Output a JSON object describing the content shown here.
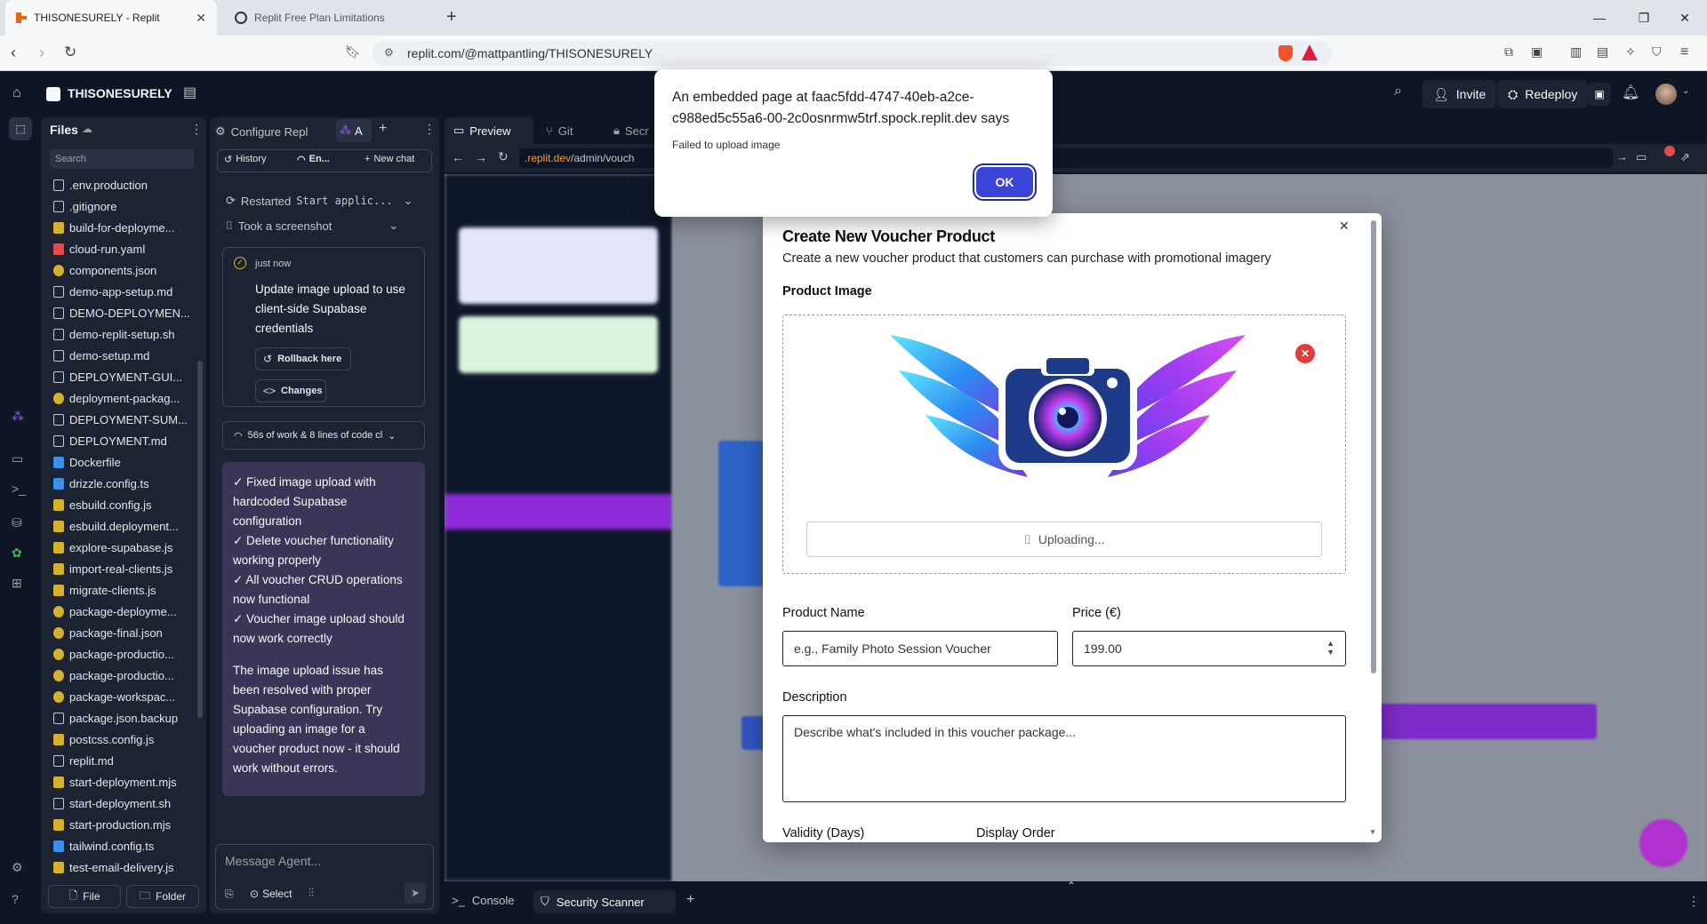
{
  "browser": {
    "tabs": [
      {
        "title": "THISONESURELY - Replit",
        "active": true
      },
      {
        "title": "Replit Free Plan Limitations",
        "active": false
      }
    ],
    "url": "replit.com/@mattpantling/THISONESURELY"
  },
  "topbar": {
    "project_name": "THISONESURELY",
    "invite_label": "Invite",
    "redeploy_label": "Redeploy"
  },
  "files": {
    "title": "Files",
    "search_placeholder": "Search",
    "items": [
      {
        "name": ".env.production",
        "icon": "doc",
        "color": "#c5c9d0"
      },
      {
        "name": ".gitignore",
        "icon": "doc",
        "color": "#c5c9d0"
      },
      {
        "name": "build-for-deployme...",
        "icon": "js",
        "color": "#d8b12c"
      },
      {
        "name": "cloud-run.yaml",
        "icon": "yaml",
        "color": "#e44b4b"
      },
      {
        "name": "components.json",
        "icon": "json",
        "color": "#d8b12c"
      },
      {
        "name": "demo-app-setup.md",
        "icon": "md",
        "color": "#c5c9d0"
      },
      {
        "name": "DEMO-DEPLOYMEN...",
        "icon": "md",
        "color": "#c5c9d0"
      },
      {
        "name": "demo-replit-setup.sh",
        "icon": "sh",
        "color": "#c5c9d0"
      },
      {
        "name": "demo-setup.md",
        "icon": "md",
        "color": "#c5c9d0"
      },
      {
        "name": "DEPLOYMENT-GUI...",
        "icon": "md",
        "color": "#c5c9d0"
      },
      {
        "name": "deployment-packag...",
        "icon": "json",
        "color": "#d8b12c"
      },
      {
        "name": "DEPLOYMENT-SUM...",
        "icon": "md",
        "color": "#c5c9d0"
      },
      {
        "name": "DEPLOYMENT.md",
        "icon": "md",
        "color": "#c5c9d0"
      },
      {
        "name": "Dockerfile",
        "icon": "docker",
        "color": "#3b8eea"
      },
      {
        "name": "drizzle.config.ts",
        "icon": "ts",
        "color": "#3b8eea"
      },
      {
        "name": "esbuild.config.js",
        "icon": "js",
        "color": "#d8b12c"
      },
      {
        "name": "esbuild.deployment...",
        "icon": "js",
        "color": "#d8b12c"
      },
      {
        "name": "explore-supabase.js",
        "icon": "js",
        "color": "#d8b12c"
      },
      {
        "name": "import-real-clients.js",
        "icon": "js",
        "color": "#d8b12c"
      },
      {
        "name": "migrate-clients.js",
        "icon": "js",
        "color": "#d8b12c"
      },
      {
        "name": "package-deployme...",
        "icon": "json",
        "color": "#d8b12c"
      },
      {
        "name": "package-final.json",
        "icon": "json",
        "color": "#d8b12c"
      },
      {
        "name": "package-productio...",
        "icon": "json",
        "color": "#d8b12c"
      },
      {
        "name": "package-productio...",
        "icon": "json",
        "color": "#d8b12c"
      },
      {
        "name": "package-workspac...",
        "icon": "json",
        "color": "#d8b12c"
      },
      {
        "name": "package.json.backup",
        "icon": "md",
        "color": "#c5c9d0"
      },
      {
        "name": "postcss.config.js",
        "icon": "js",
        "color": "#d8b12c"
      },
      {
        "name": "replit.md",
        "icon": "md",
        "color": "#c5c9d0"
      },
      {
        "name": "start-deployment.mjs",
        "icon": "js",
        "color": "#d8b12c"
      },
      {
        "name": "start-deployment.sh",
        "icon": "sh",
        "color": "#c5c9d0"
      },
      {
        "name": "start-production.mjs",
        "icon": "js",
        "color": "#d8b12c"
      },
      {
        "name": "tailwind.config.ts",
        "icon": "ts",
        "color": "#3b8eea"
      },
      {
        "name": "test-email-delivery.js",
        "icon": "js",
        "color": "#d8b12c"
      }
    ],
    "new_file_label": "File",
    "new_folder_label": "Folder"
  },
  "agent": {
    "tabs": {
      "configure": "Configure Repl",
      "agent": "A"
    },
    "history_label": "History",
    "mode_label": "En...",
    "new_chat_label": "New chat",
    "actions": [
      {
        "label": "Restarted",
        "mono": "Start applic..."
      },
      {
        "label": "Took a screenshot",
        "mono": ""
      }
    ],
    "checkpoint": {
      "time": "just now",
      "message": "Update image upload to use client-side Supabase credentials",
      "rollback_label": "Rollback here",
      "changes_label": "Changes"
    },
    "work_summary": "56s of work & 8 lines of code cl",
    "response_lines": [
      "✓ Fixed image upload with",
      "hardcoded Supabase",
      "configuration",
      "✓ Delete voucher functionality",
      "working properly",
      "✓ All voucher CRUD operations",
      "now functional",
      "✓ Voucher image upload should",
      "now work correctly"
    ],
    "response_paragraph_lines": [
      "The image upload issue has",
      "been resolved with proper",
      "Supabase configuration. Try",
      "uploading an image for a",
      "voucher product now - it should",
      "work without errors."
    ],
    "message_placeholder": "Message Agent...",
    "select_label": "Select"
  },
  "preview": {
    "tabs": {
      "preview": "Preview",
      "git": "Git",
      "secrets": "Secr"
    },
    "url_domain": ".replit.dev",
    "url_path": "/admin/vouch"
  },
  "modal": {
    "title": "Create New Voucher Product",
    "subtitle": "Create a new voucher product that customers can purchase with promotional imagery",
    "product_image_label": "Product Image",
    "uploading_label": "Uploading...",
    "product_name_label": "Product Name",
    "product_name_placeholder": "e.g., Family Photo Session Voucher",
    "price_label": "Price (€)",
    "price_value": "199.00",
    "description_label": "Description",
    "description_placeholder": "Describe what's included in this voucher package...",
    "validity_label": "Validity (Days)",
    "display_order_label": "Display Order"
  },
  "alert": {
    "title": "An embedded page at faac5fdd-4747-40eb-a2ce-c988ed5c55a6-00-2c0osnrmw5trf.spock.replit.dev says",
    "title_line1": "An embedded page at faac5fdd-4747-40eb-a2ce-",
    "title_line2": "c988ed5c55a6-00-2c0osnrmw5trf.spock.replit.dev says",
    "message": "Failed to upload image",
    "ok_label": "OK"
  },
  "bottom_tabs": {
    "console": "Console",
    "security_scanner": "Security Scanner"
  },
  "colors": {
    "replit_bg": "#0e1525",
    "panel_bg": "#1c2333",
    "accent_blue": "#3b44d6",
    "agent_message_bg": "#3a3658",
    "purple": "#9b30e8"
  }
}
